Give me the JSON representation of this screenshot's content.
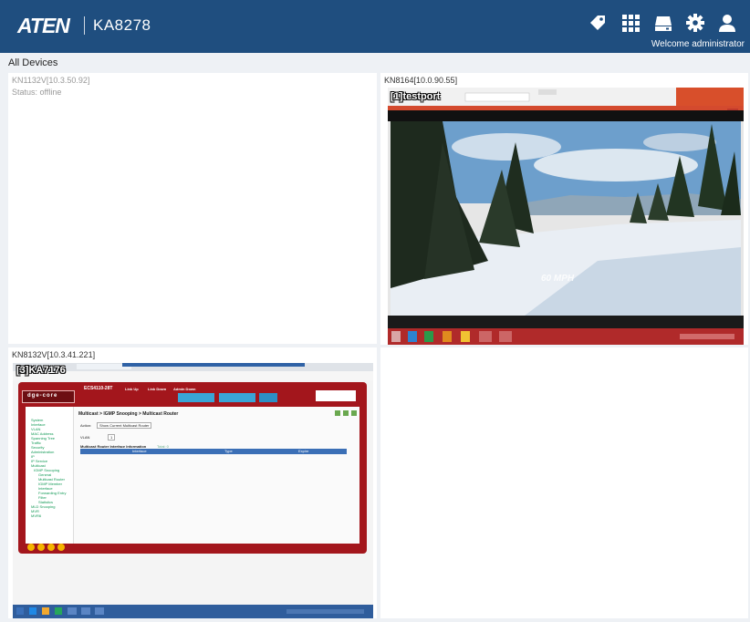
{
  "app": {
    "logo": "ATEN",
    "model": "KA8278",
    "welcome": "Welcome administrator"
  },
  "breadcrumb": "All Devices",
  "icons": [
    "tag-icon",
    "grid-icon",
    "device-icon",
    "gear-icon",
    "user-icon"
  ],
  "colors": {
    "header": "#1f4e7f",
    "panel": "#ffffff",
    "background": "#eef1f5"
  },
  "panels": [
    {
      "label": "KN1132V[10.3.50.92]",
      "status": "Status: offline"
    },
    {
      "label": "KN8164[10.0.90.55]",
      "overlay": "[1]testport",
      "video_text": "60 MPH"
    },
    {
      "label": "KN8132V[10.3.41.221]",
      "overlay": "[3]KA7176",
      "app_name": "dge-core",
      "app_model": "ECS4110-28T",
      "link_up": "Link Up",
      "link_down": "Link Down",
      "admin_down": "Admin Down",
      "page_heading": "Multicast > IGMP Snooping > Multicast Router",
      "action_label": "Action:",
      "action_value": "Show Current Multicast Router",
      "vlan_label": "VLAN",
      "vlan_value": "1",
      "table_title": "Multicast Router Interface Information",
      "table_total": "Total: 0",
      "columns": [
        "Interface",
        "Type",
        "Expire"
      ],
      "menu": [
        "System",
        "Interface",
        "VLAN",
        "MAC Address",
        "Spanning Tree",
        "Traffic",
        "Security",
        "Administration",
        "IP",
        "IP Service",
        "Multicast",
        "IGMP Snooping",
        "General",
        "Multicast Router",
        "IGMP Member",
        "Interface",
        "Forwarding Entry",
        "Filter",
        "Statistics",
        "MLD Snooping",
        "MVR",
        "MVR6"
      ]
    },
    {
      "label": ""
    }
  ]
}
